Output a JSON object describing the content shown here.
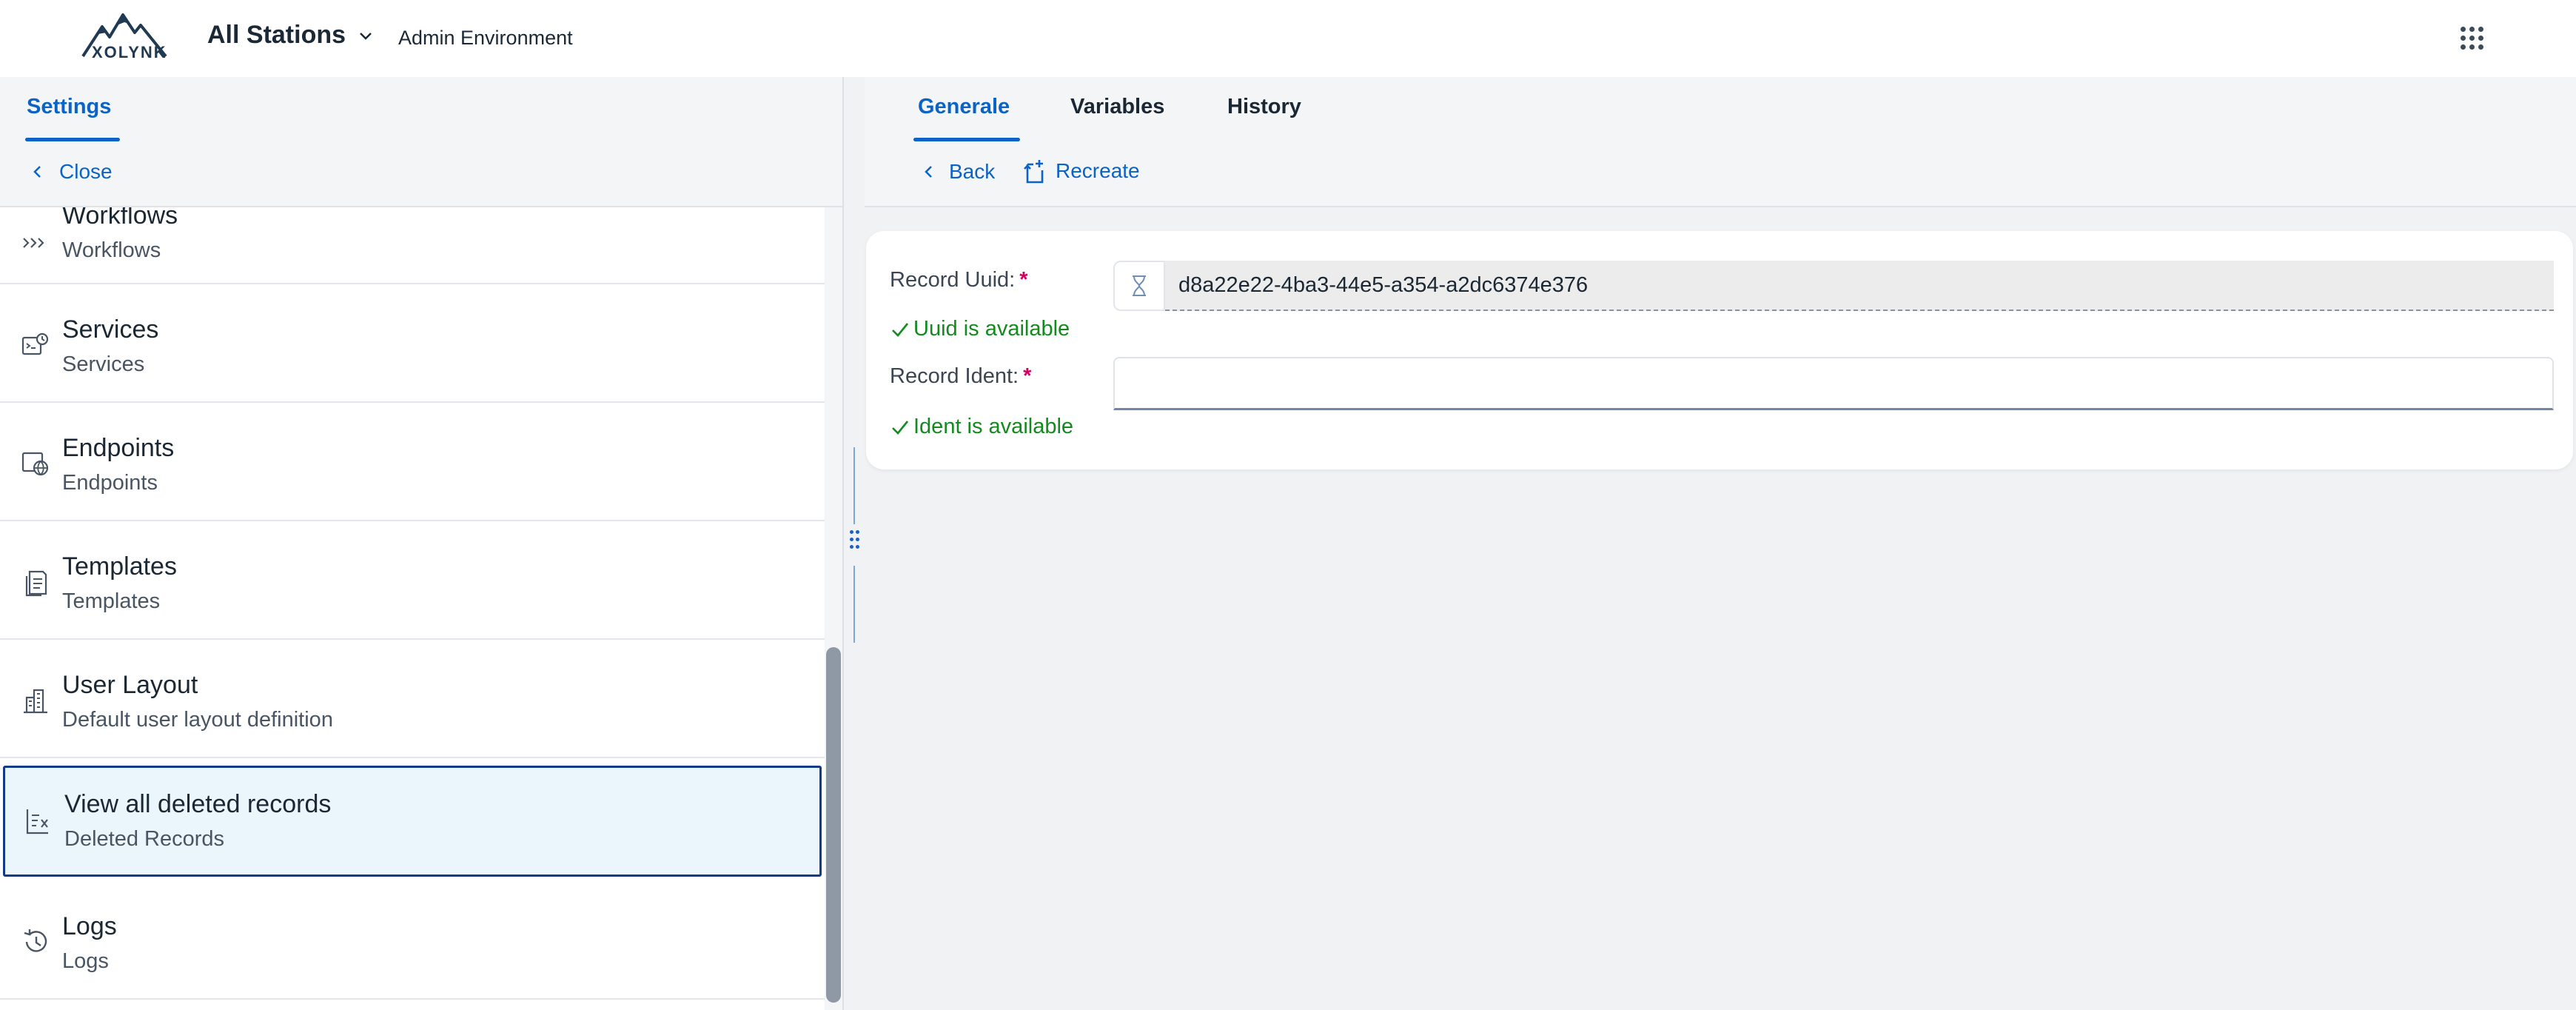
{
  "header": {
    "logo_text": "XOLYNK",
    "station": "All Stations",
    "environment": "Admin Environment"
  },
  "left": {
    "tab": "Settings",
    "close_label": "Close",
    "items": [
      {
        "title": "Workflows",
        "subtitle": "Workflows",
        "icon": "workflow-icon"
      },
      {
        "title": "Services",
        "subtitle": "Services",
        "icon": "services-icon"
      },
      {
        "title": "Endpoints",
        "subtitle": "Endpoints",
        "icon": "endpoints-icon"
      },
      {
        "title": "Templates",
        "subtitle": "Templates",
        "icon": "templates-icon"
      },
      {
        "title": "User Layout",
        "subtitle": "Default user layout definition",
        "icon": "layout-icon"
      },
      {
        "title": "View all deleted records",
        "subtitle": "Deleted Records",
        "icon": "deleted-records-icon",
        "selected": true
      },
      {
        "title": "Logs",
        "subtitle": "Logs",
        "icon": "history-icon"
      }
    ]
  },
  "right": {
    "tabs": [
      {
        "label": "Generale",
        "active": true
      },
      {
        "label": "Variables",
        "active": false
      },
      {
        "label": "History",
        "active": false
      }
    ],
    "back_label": "Back",
    "recreate_label": "Recreate",
    "form": {
      "uuid_label": "Record Uuid:",
      "uuid_value": "d8a22e22-4ba3-44e5-a354-a2dc6374e376",
      "uuid_status": "Uuid is available",
      "ident_label": "Record Ident:",
      "ident_value": "",
      "ident_status": "Ident is available",
      "required_mark": "*"
    }
  },
  "colors": {
    "accent": "#0b63c5",
    "success": "#138a1e",
    "required": "#d1005f",
    "selected_bg": "#eaf5fc",
    "selected_border": "#133b8a"
  }
}
